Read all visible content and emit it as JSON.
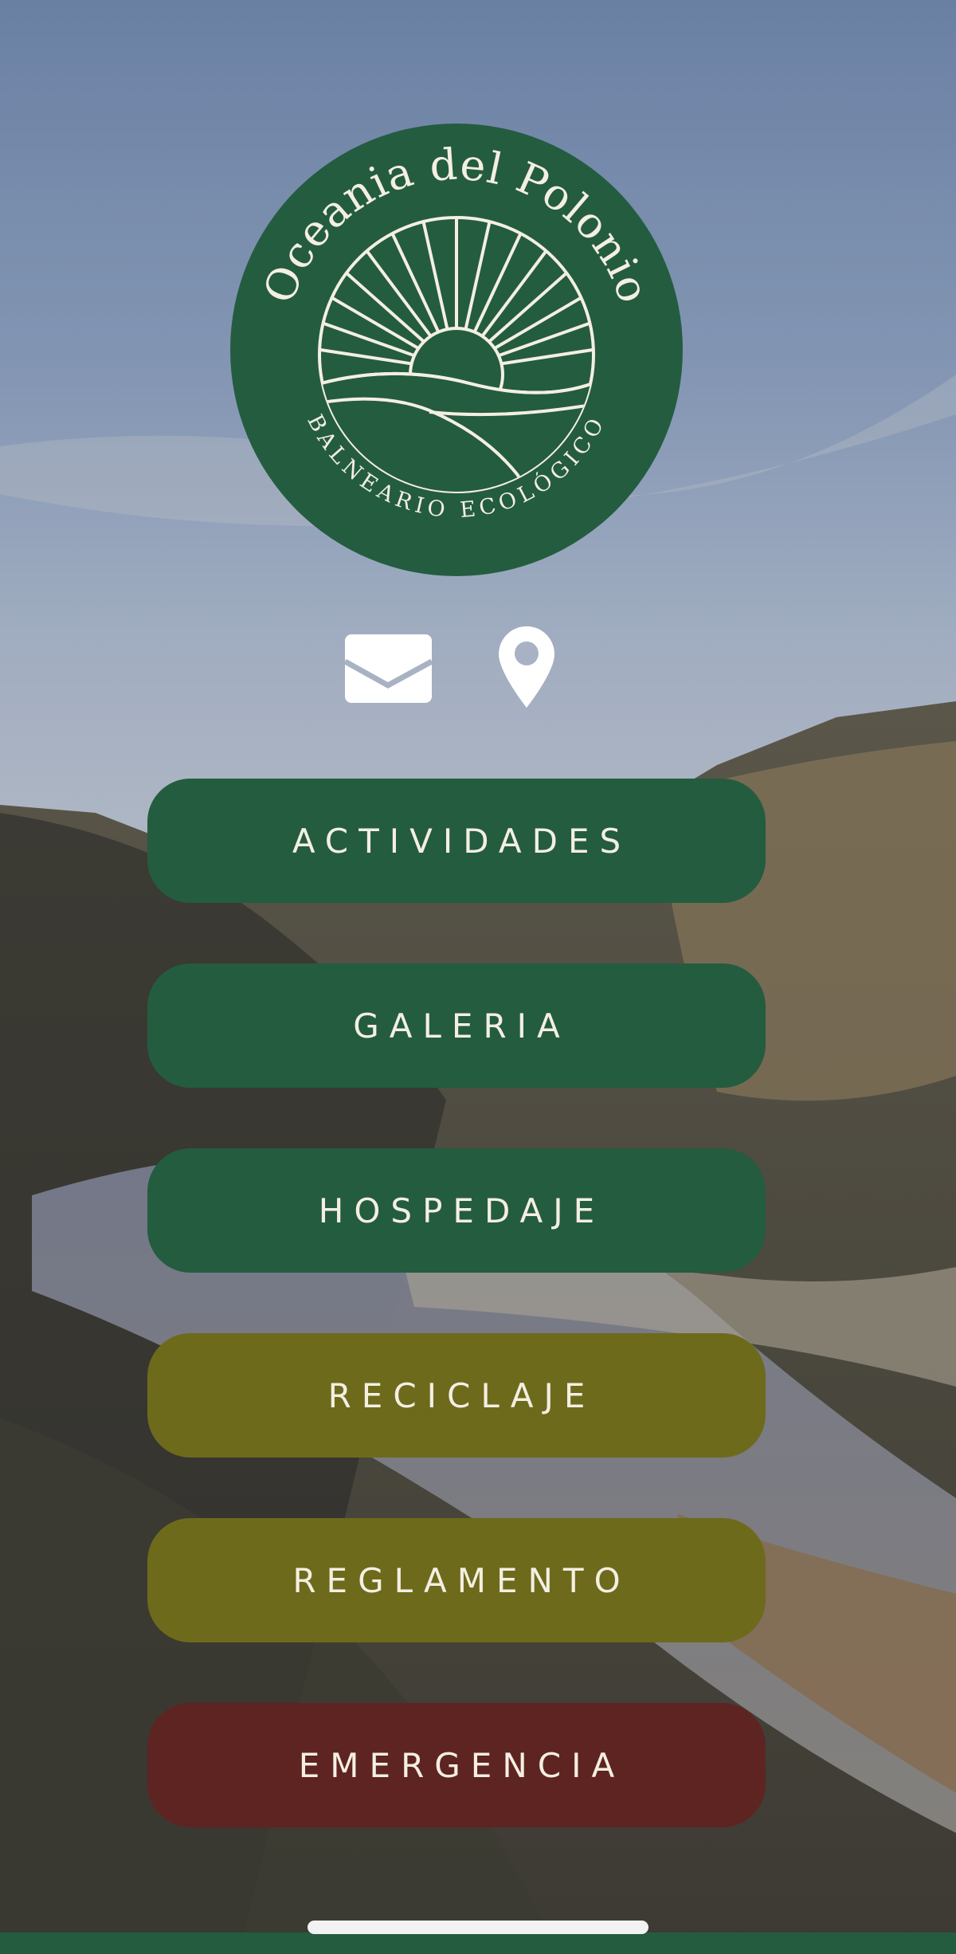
{
  "logo": {
    "title": "Oceania del Polonio",
    "subtitle": "BALNEARIO ECOLÓGICO",
    "color": "#245c40"
  },
  "contact": {
    "mail_icon": "mail-icon",
    "location_icon": "map-pin-icon"
  },
  "menu": {
    "items": [
      {
        "label": "ACTIVIDADES",
        "color": "#245c40"
      },
      {
        "label": "GALERIA",
        "color": "#245c40"
      },
      {
        "label": "HOSPEDAJE",
        "color": "#245c40"
      },
      {
        "label": "RECICLAJE",
        "color": "#6d6a1c"
      },
      {
        "label": "REGLAMENTO",
        "color": "#6d6a1c"
      },
      {
        "label": "EMERGENCIA",
        "color": "#5e2422"
      }
    ]
  }
}
